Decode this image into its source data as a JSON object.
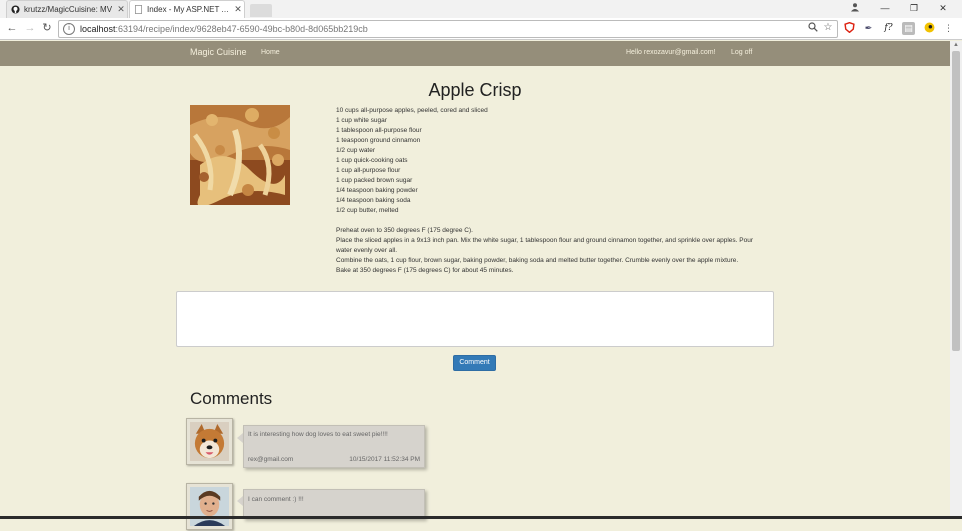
{
  "browser": {
    "tabs": [
      {
        "title": "krutzz/MagicCuisine: MV",
        "icon": "github-icon",
        "active": false
      },
      {
        "title": "Index - My ASP.NET App",
        "icon": "page-icon",
        "active": true
      }
    ],
    "url_host": "localhost",
    "url_path": ":63194/recipe/index/9628eb47-6590-49bc-b80d-8d065bb219cb"
  },
  "navbar": {
    "brand": "Magic Cuisine",
    "home": "Home",
    "greeting": "Hello rexozavur@gmail.com!",
    "logoff": "Log off"
  },
  "recipe": {
    "title": "Apple Crisp",
    "ingredients": [
      "10 cups all-purpose apples, peeled, cored and sliced",
      "1 cup white sugar",
      "1 tablespoon all-purpose flour",
      "1 teaspoon ground cinnamon",
      "1/2 cup water",
      "1 cup quick-cooking oats",
      "1 cup all-purpose flour",
      "1 cup packed brown sugar",
      "1/4 teaspoon baking powder",
      "1/4 teaspoon baking soda",
      "1/2 cup butter, melted"
    ],
    "directions": [
      "Preheat oven to 350 degrees F (175 degree C).",
      "Place the sliced apples in a 9x13 inch pan. Mix the white sugar, 1 tablespoon flour and ground cinnamon together, and sprinkle over apples. Pour water evenly over all.",
      "Combine the oats, 1 cup flour, brown sugar, baking powder, baking soda and melted butter together. Crumble evenly over the apple mixture.",
      "Bake at 350 degrees F (175 degrees C) for about 45 minutes."
    ]
  },
  "comment_form": {
    "placeholder": "",
    "button": "Comment"
  },
  "comments": {
    "heading": "Comments",
    "items": [
      {
        "text": "It is interesting how dog loves to eat sweet pie!!!!",
        "author": "rex@gmail.com",
        "date": "10/15/2017 11:52:34 PM"
      },
      {
        "text": "I can comment :) !!!",
        "author": "",
        "date": ""
      }
    ]
  },
  "colors": {
    "navbar": "#958e7a",
    "page_bg": "#f1efdc",
    "button": "#337ab7",
    "comment_card": "#d6d3cd"
  }
}
